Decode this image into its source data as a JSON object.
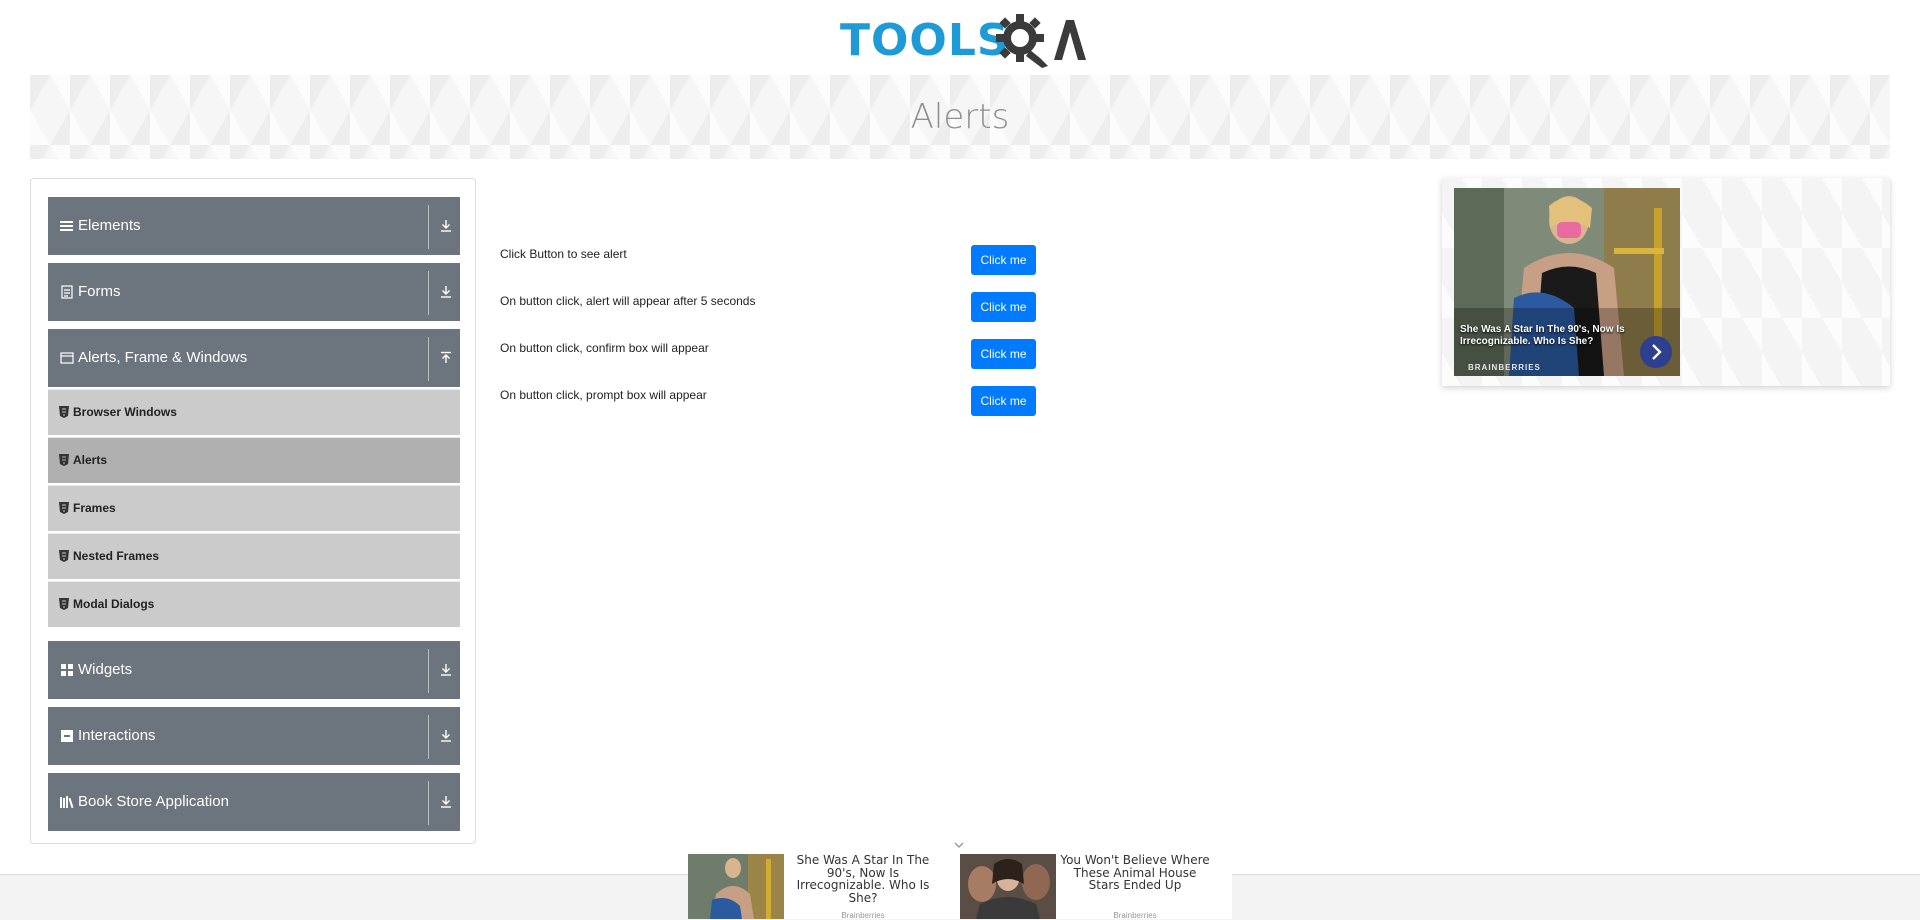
{
  "logo": {
    "text": "TOOLS",
    "suffix": "QA"
  },
  "banner": {
    "title": "Alerts"
  },
  "sidebar": {
    "groups": [
      {
        "label": "Elements",
        "icon": "menu-icon"
      },
      {
        "label": "Forms",
        "icon": "document-icon"
      },
      {
        "label": "Alerts, Frame & Windows",
        "icon": "window-icon",
        "expanded": true
      },
      {
        "label": "Widgets",
        "icon": "grid-icon"
      },
      {
        "label": "Interactions",
        "icon": "square-icon"
      },
      {
        "label": "Book Store Application",
        "icon": "books-icon"
      }
    ],
    "items": [
      {
        "label": "Browser Windows"
      },
      {
        "label": "Alerts",
        "active": true
      },
      {
        "label": "Frames"
      },
      {
        "label": "Nested Frames"
      },
      {
        "label": "Modal Dialogs"
      }
    ]
  },
  "main": {
    "rows": [
      {
        "text": "Click Button to see alert",
        "button": "Click me"
      },
      {
        "text": "On button click, alert will appear after 5 seconds",
        "button": "Click me"
      },
      {
        "text": "On button click, confirm box will appear",
        "button": "Click me"
      },
      {
        "text": "On button click, prompt box will appear",
        "button": "Click me"
      }
    ]
  },
  "ad": {
    "caption": "She Was A Star In The 90's, Now Is Irrecognizable. Who Is She?",
    "brand": "BRAINBERRIES"
  },
  "bottom_ads": [
    {
      "title": "She Was A Star In The 90's, Now Is Irrecognizable. Who Is She?",
      "source": "Brainberries"
    },
    {
      "title": "You Won't Believe Where These Animal House Stars Ended Up",
      "source": "Brainberries"
    }
  ],
  "colors": {
    "sidebar_group": "#6c757d",
    "button": "#007bff",
    "logo_blue": "#1e9bd7"
  }
}
